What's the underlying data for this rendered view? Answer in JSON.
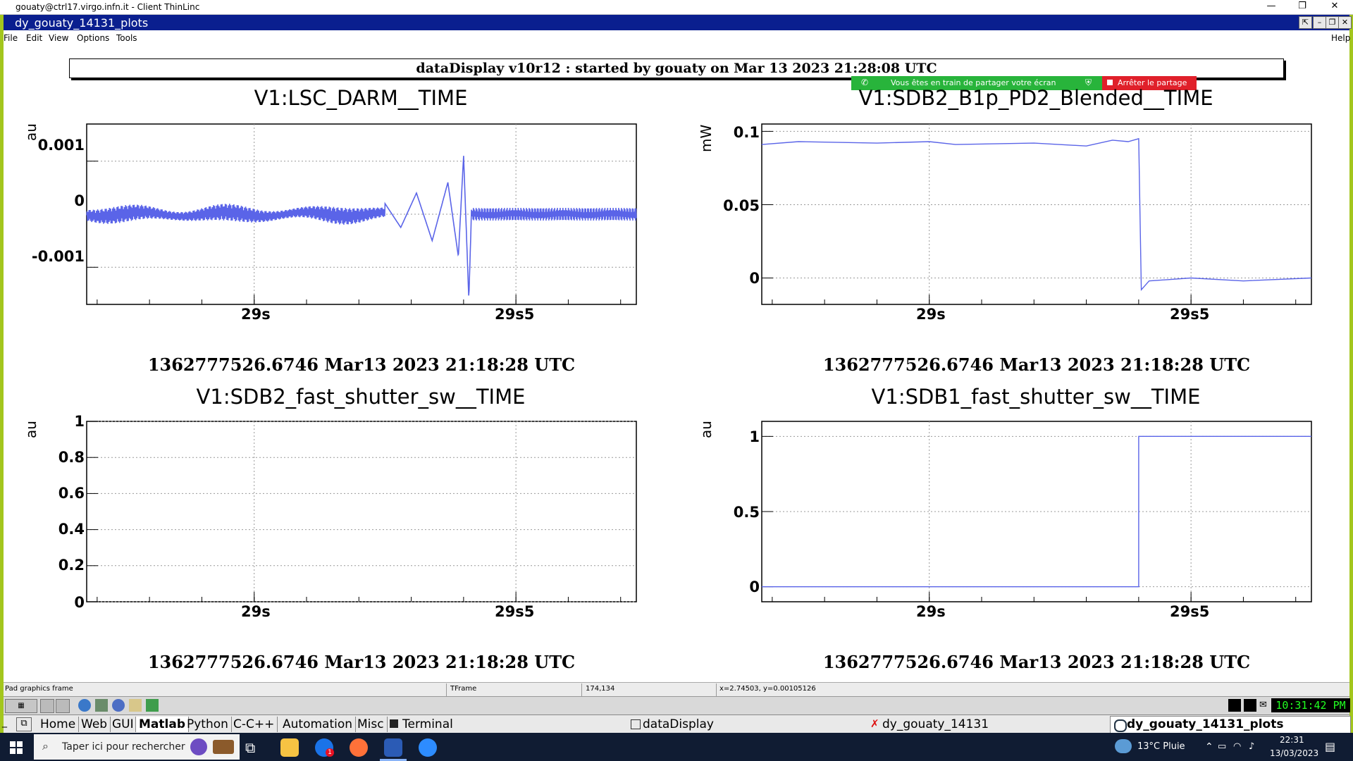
{
  "outer_window": {
    "title": "gouaty@ctrl17.virgo.infn.it - Client ThinLinc",
    "controls": [
      "—",
      "❐",
      "✕"
    ]
  },
  "inner_window": {
    "title": "dy_gouaty_14131_plots",
    "controls": [
      "⇱",
      "–",
      "❐",
      "✕"
    ]
  },
  "menu": {
    "items": [
      "File",
      "Edit",
      "View",
      "Options",
      "Tools"
    ],
    "help": "Help"
  },
  "header": "dataDisplay v10r12 : started by gouaty on Mar 13 2023 21:28:08 UTC",
  "sharing_banner": {
    "message": "Vous êtes en train de partager votre écran",
    "stop_label": "Arrêter le partage"
  },
  "plots": [
    {
      "title": "V1:LSC_DARM__TIME",
      "ylabel": "au",
      "yticks": [
        "0.001",
        "0",
        "-0.001"
      ],
      "xticks": [
        "29s",
        "29s5"
      ],
      "timestamp": "1362777526.6746 Mar13 2023 21:18:28 UTC"
    },
    {
      "title": "V1:SDB2_B1p_PD2_Blended__TIME",
      "ylabel": "mW",
      "yticks": [
        "0.1",
        "0.05",
        "0"
      ],
      "xticks": [
        "29s",
        "29s5"
      ],
      "timestamp": "1362777526.6746 Mar13 2023 21:18:28 UTC"
    },
    {
      "title": "V1:SDB2_fast_shutter_sw__TIME",
      "ylabel": "au",
      "yticks": [
        "1",
        "0.8",
        "0.6",
        "0.4",
        "0.2",
        "0"
      ],
      "xticks": [
        "29s",
        "29s5"
      ],
      "timestamp": "1362777526.6746 Mar13 2023 21:18:28 UTC"
    },
    {
      "title": "V1:SDB1_fast_shutter_sw__TIME",
      "ylabel": "au",
      "yticks": [
        "1",
        "0.5",
        "0"
      ],
      "xticks": [
        "29s",
        "29s5"
      ],
      "timestamp": "1362777526.6746 Mar13 2023 21:18:28 UTC"
    }
  ],
  "chart_data": [
    {
      "type": "line",
      "title": "V1:LSC_DARM__TIME",
      "ylabel": "au",
      "x_ticks": [
        "29s",
        "29s5"
      ],
      "ylim": [
        -0.0017,
        0.0017
      ],
      "series": [
        {
          "x": [
            28.68,
            28.8,
            28.9,
            29.0,
            29.1,
            29.2,
            29.25,
            29.28,
            29.31,
            29.34,
            29.37,
            29.39,
            29.4,
            29.41,
            29.45,
            29.6,
            29.73
          ],
          "y": [
            0.0,
            0.0001,
            0.0,
            5e-05,
            0.0,
            0.0001,
            0.0002,
            -0.00025,
            0.0004,
            -0.0005,
            0.0006,
            -0.0008,
            0.0011,
            -0.0016,
            0.0,
            0.0,
            0.0
          ]
        }
      ]
    },
    {
      "type": "line",
      "title": "V1:SDB2_B1p_PD2_Blended__TIME",
      "ylabel": "mW",
      "x_ticks": [
        "29s",
        "29s5"
      ],
      "ylim": [
        -0.018,
        0.105
      ],
      "series": [
        {
          "x": [
            28.68,
            28.75,
            28.9,
            29.0,
            29.05,
            29.2,
            29.3,
            29.35,
            29.38,
            29.4,
            29.405,
            29.42,
            29.5,
            29.6,
            29.73
          ],
          "y": [
            0.091,
            0.093,
            0.092,
            0.093,
            0.091,
            0.092,
            0.09,
            0.094,
            0.093,
            0.095,
            -0.008,
            -0.002,
            0.0,
            -0.002,
            0.0
          ]
        }
      ]
    },
    {
      "type": "line",
      "title": "V1:SDB2_fast_shutter_sw__TIME",
      "ylabel": "au",
      "x_ticks": [
        "29s",
        "29s5"
      ],
      "ylim": [
        0,
        1
      ],
      "series": [
        {
          "x": [],
          "y": []
        }
      ]
    },
    {
      "type": "line",
      "title": "V1:SDB1_fast_shutter_sw__TIME",
      "ylabel": "au",
      "x_ticks": [
        "29s",
        "29s5"
      ],
      "ylim": [
        -0.1,
        1.1
      ],
      "series": [
        {
          "x": [
            28.68,
            29.4,
            29.4,
            29.73
          ],
          "y": [
            0,
            0,
            1,
            1
          ]
        }
      ]
    }
  ],
  "statusbar": {
    "object": "Pad graphics frame",
    "class": "TFrame",
    "pixel": "174,134",
    "coords": "x=2.74503, y=0.00105126"
  },
  "clock": "10:31:42 PM",
  "bottom_tabs": [
    "Home",
    "Web",
    "GUI",
    "Matlab",
    "Python",
    "C-C++",
    "Automation",
    "Misc"
  ],
  "active_tab": "Matlab",
  "windows": [
    "Terminal",
    "dataDisplay",
    "dy_gouaty_14131",
    "dy_gouaty_14131_plots"
  ],
  "taskbar": {
    "search_placeholder": "Taper ici pour rechercher",
    "weather": "13°C  Pluie",
    "time": "22:31",
    "date": "13/03/2023"
  }
}
